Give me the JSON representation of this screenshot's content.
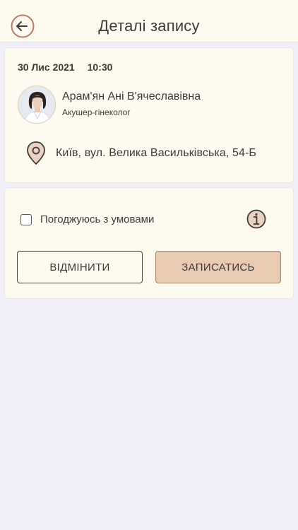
{
  "header": {
    "title": "Деталі запису",
    "back_icon": "arrow-left-circle-icon"
  },
  "appointment": {
    "date": "30 Лис 2021",
    "time": "10:30",
    "doctor": {
      "name": "Арам'ян Ані В'ячеславівна",
      "specialty": "Акушер-гінеколог"
    },
    "address": "Київ, вул. Велика Васильківська, 54-Б",
    "location_icon": "map-pin-icon"
  },
  "actions": {
    "agree_label": "Погоджуюсь з умовами",
    "agree_checked": false,
    "info_icon": "info-icon",
    "cancel_label": "ВІДМІНИТИ",
    "submit_label": "ЗАПИСАТИСЬ"
  },
  "colors": {
    "card_bg": "#fdfbef",
    "page_bg": "#efeef9",
    "accent": "#e8cbb0",
    "icon_accent": "#c07862"
  }
}
